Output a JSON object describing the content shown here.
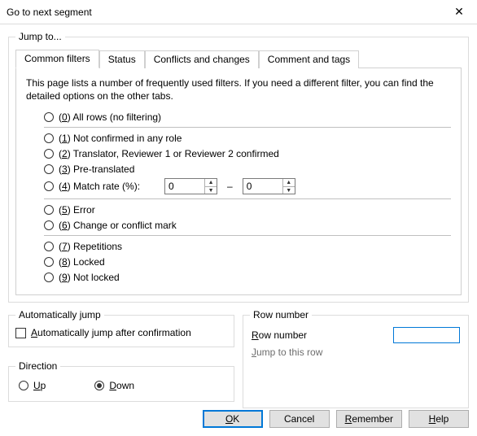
{
  "window": {
    "title": "Go to next segment",
    "close_glyph": "✕"
  },
  "jump": {
    "legend": "Jump to...",
    "tabs": [
      {
        "label": "Common filters",
        "active": true
      },
      {
        "label": "Status",
        "active": false
      },
      {
        "label": "Conflicts and changes",
        "active": false
      },
      {
        "label": "Comment and tags",
        "active": false
      }
    ],
    "desc": "This page lists a number of frequently used filters. If you need a different filter, you can find the detailed options on the other tabs.",
    "options": {
      "opt0": "(0) All rows (no filtering)",
      "opt1": "(1) Not confirmed in any role",
      "opt2": "(2) Translator, Reviewer 1 or Reviewer 2 confirmed",
      "opt3": "(3) Pre-translated",
      "opt4_label": "(4) Match rate (%):",
      "opt4_from": "0",
      "opt4_to": "0",
      "dash": "–",
      "opt5": "(5) Error",
      "opt6": "(6) Change or conflict mark",
      "opt7": "(7) Repetitions",
      "opt8": "(8) Locked",
      "opt9": "(9) Not locked"
    }
  },
  "auto": {
    "legend": "Automatically jump",
    "checkbox_label": "Automatically jump after confirmation",
    "checked": false
  },
  "direction": {
    "legend": "Direction",
    "up_label": "Up",
    "down_label": "Down",
    "selected": "down"
  },
  "rownum": {
    "legend": "Row number",
    "label": "Row number",
    "value": "",
    "jump_link": "Jump to this row"
  },
  "buttons": {
    "ok": "OK",
    "cancel": "Cancel",
    "remember": "Remember",
    "help": "Help"
  }
}
